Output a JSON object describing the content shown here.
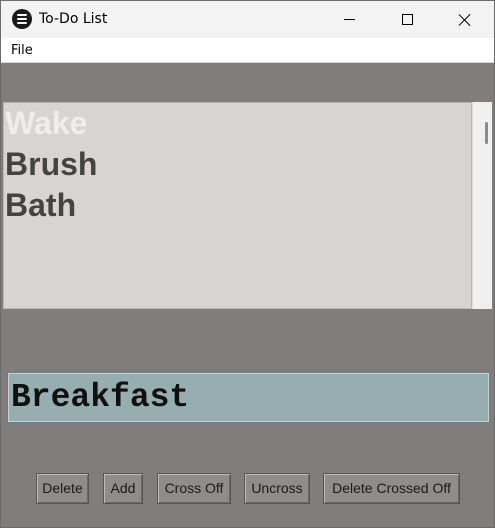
{
  "window": {
    "title": "To-Do List"
  },
  "menu": {
    "file_label": "File"
  },
  "list": {
    "items": [
      {
        "label": "Wake",
        "selected": true
      },
      {
        "label": "Brush",
        "selected": false
      },
      {
        "label": "Bath",
        "selected": false
      }
    ]
  },
  "entry": {
    "value": "Breakfast"
  },
  "buttons": {
    "delete": "Delete",
    "add": "Add",
    "cross_off": "Cross Off",
    "uncross": "Uncross",
    "delete_crossed_off": "Delete Crossed Off"
  },
  "colors": {
    "background": "#807d7c",
    "list_bg": "#d8d4d3",
    "entry_bg": "#97aeb1"
  }
}
